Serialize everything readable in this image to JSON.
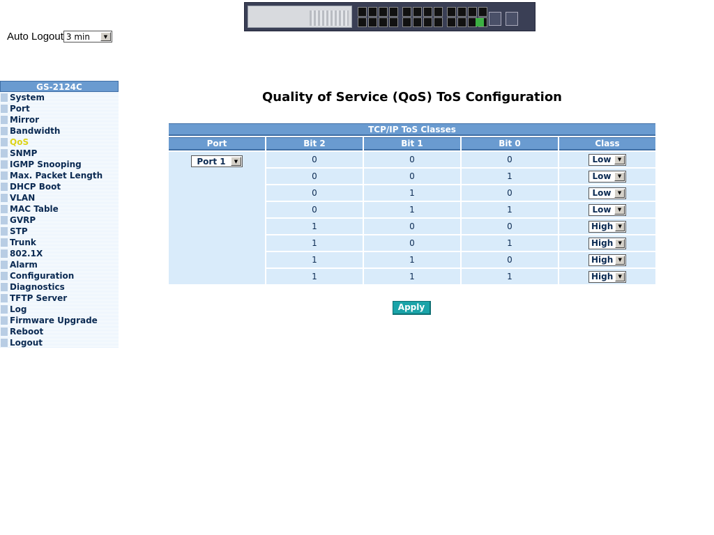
{
  "header": {
    "auto_logout_label": "Auto Logout",
    "auto_logout_value": "3 min"
  },
  "sidebar": {
    "model": "GS-2124C",
    "items": [
      {
        "label": "System"
      },
      {
        "label": "Port"
      },
      {
        "label": "Mirror"
      },
      {
        "label": "Bandwidth"
      },
      {
        "label": "QoS",
        "active": true
      },
      {
        "label": "SNMP"
      },
      {
        "label": "IGMP Snooping"
      },
      {
        "label": "Max. Packet Length"
      },
      {
        "label": "DHCP Boot"
      },
      {
        "label": "VLAN"
      },
      {
        "label": "MAC Table"
      },
      {
        "label": "GVRP"
      },
      {
        "label": "STP"
      },
      {
        "label": "Trunk"
      },
      {
        "label": "802.1X"
      },
      {
        "label": "Alarm"
      },
      {
        "label": "Configuration"
      },
      {
        "label": "Diagnostics"
      },
      {
        "label": "TFTP Server"
      },
      {
        "label": "Log"
      },
      {
        "label": "Firmware Upgrade"
      },
      {
        "label": "Reboot"
      },
      {
        "label": "Logout"
      }
    ]
  },
  "main": {
    "title": "Quality of Service (QoS) ToS Configuration",
    "table_caption": "TCP/IP ToS Classes",
    "columns": [
      "Port",
      "Bit 2",
      "Bit 1",
      "Bit 0",
      "Class"
    ],
    "port_value": "Port 1",
    "rows": [
      {
        "bit2": "0",
        "bit1": "0",
        "bit0": "0",
        "class": "Low"
      },
      {
        "bit2": "0",
        "bit1": "0",
        "bit0": "1",
        "class": "Low"
      },
      {
        "bit2": "0",
        "bit1": "1",
        "bit0": "0",
        "class": "Low"
      },
      {
        "bit2": "0",
        "bit1": "1",
        "bit0": "1",
        "class": "Low"
      },
      {
        "bit2": "1",
        "bit1": "0",
        "bit0": "0",
        "class": "High"
      },
      {
        "bit2": "1",
        "bit1": "0",
        "bit0": "1",
        "class": "High"
      },
      {
        "bit2": "1",
        "bit1": "1",
        "bit0": "0",
        "class": "High"
      },
      {
        "bit2": "1",
        "bit1": "1",
        "bit0": "1",
        "class": "High"
      }
    ],
    "apply_label": "Apply"
  },
  "colors": {
    "header_blue": "#6a9bd0",
    "cell_blue": "#d9ebfa",
    "active_menu": "#ddd319",
    "apply_teal": "#1aa3a8"
  }
}
